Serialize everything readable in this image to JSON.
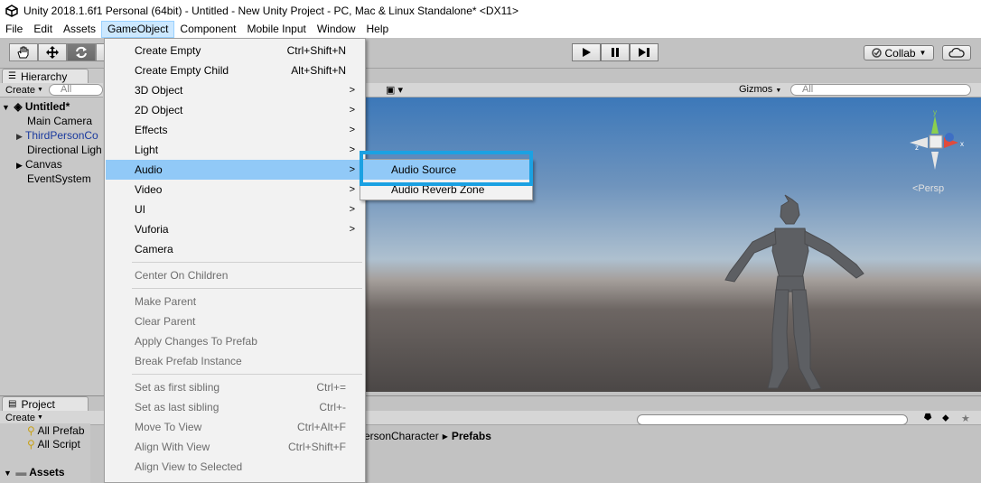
{
  "window": {
    "title": "Unity 2018.1.6f1 Personal (64bit) - Untitled - New Unity Project - PC, Mac & Linux Standalone* <DX11>",
    "logo_icon": "unity-logo-icon"
  },
  "menubar": [
    "File",
    "Edit",
    "Assets",
    "GameObject",
    "Component",
    "Mobile Input",
    "Window",
    "Help"
  ],
  "toolbar": {
    "tools": [
      "hand-icon",
      "move-icon",
      "rotate-icon"
    ],
    "play_controls": [
      "play-icon",
      "pause-icon",
      "step-icon"
    ],
    "collab_label": "Collab",
    "cloud_icon": "cloud-icon"
  },
  "hierarchy": {
    "tab_label": "Hierarchy",
    "create_label": "Create",
    "search_placeholder": "All",
    "scene_name": "Untitled*",
    "items": [
      {
        "label": "Main Camera",
        "expandable": false,
        "prefab": false
      },
      {
        "label": "ThirdPersonCo",
        "expandable": true,
        "prefab": true
      },
      {
        "label": "Directional Ligh",
        "expandable": false,
        "prefab": false
      },
      {
        "label": "Canvas",
        "expandable": true,
        "prefab": false
      },
      {
        "label": "EventSystem",
        "expandable": false,
        "prefab": false
      }
    ]
  },
  "scene": {
    "gizmos_label": "Gizmos",
    "search_placeholder": "All",
    "persp_label": "<Persp",
    "axis_labels": {
      "y": "y",
      "x": "x",
      "z": "z"
    }
  },
  "project": {
    "tab_label": "Project",
    "create_label": "Create",
    "items": [
      "All Prefab",
      "All Script"
    ],
    "assets_label": "Assets",
    "breadcrumb_prefix": "ersonCharacter",
    "breadcrumb_current": "Prefabs"
  },
  "gameobject_menu": {
    "items": [
      {
        "label": "Create Empty",
        "shortcut": "Ctrl+Shift+N"
      },
      {
        "label": "Create Empty Child",
        "shortcut": "Alt+Shift+N"
      },
      {
        "label": "3D Object",
        "submenu": true
      },
      {
        "label": "2D Object",
        "submenu": true
      },
      {
        "label": "Effects",
        "submenu": true
      },
      {
        "label": "Light",
        "submenu": true
      },
      {
        "label": "Audio",
        "submenu": true,
        "highlighted": true
      },
      {
        "label": "Video",
        "submenu": true
      },
      {
        "label": "UI",
        "submenu": true
      },
      {
        "label": "Vuforia",
        "submenu": true
      },
      {
        "label": "Camera"
      },
      {
        "label": "Center On Children",
        "disabled": true
      },
      {
        "label": "Make Parent",
        "disabled": true
      },
      {
        "label": "Clear Parent",
        "disabled": true
      },
      {
        "label": "Apply Changes To Prefab",
        "disabled": true
      },
      {
        "label": "Break Prefab Instance",
        "disabled": true
      },
      {
        "label": "Set as first sibling",
        "shortcut": "Ctrl+=",
        "disabled": true
      },
      {
        "label": "Set as last sibling",
        "shortcut": "Ctrl+-",
        "disabled": true
      },
      {
        "label": "Move To View",
        "shortcut": "Ctrl+Alt+F",
        "disabled": true
      },
      {
        "label": "Align With View",
        "shortcut": "Ctrl+Shift+F",
        "disabled": true
      },
      {
        "label": "Align View to Selected",
        "disabled": true
      }
    ]
  },
  "audio_submenu": {
    "items": [
      {
        "label": "Audio Source",
        "highlighted": true
      },
      {
        "label": "Audio Reverb Zone"
      }
    ]
  },
  "colors": {
    "menu_highlight": "#91c9f7",
    "callout_border": "#1ba1e2",
    "prefab_text": "#1a3a9e"
  }
}
